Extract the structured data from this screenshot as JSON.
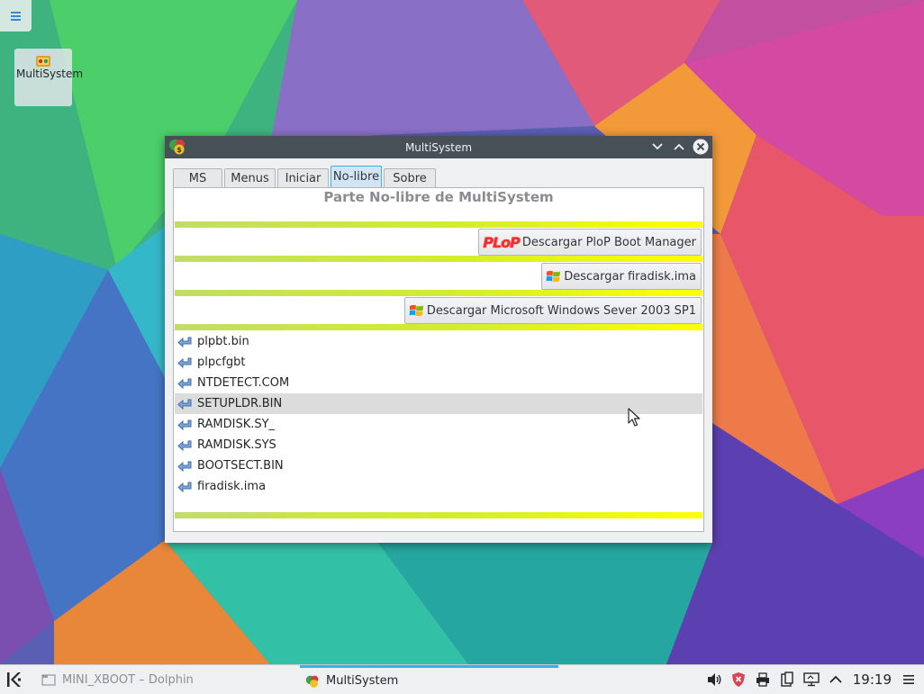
{
  "desktop": {
    "toolbox_icon": "hamburger-menu-icon",
    "icons": [
      {
        "label": "MultiSystem",
        "icon": "multisystem-icon"
      }
    ]
  },
  "window": {
    "title": "MultiSystem",
    "controls": [
      "minimize-chevron-down-icon",
      "maximize-chevron-up-icon",
      "close-icon"
    ],
    "tabs": [
      {
        "label": "MS"
      },
      {
        "label": "Menus"
      },
      {
        "label": "Iniciar"
      },
      {
        "label": "No-libre",
        "active": true
      },
      {
        "label": "Sobre"
      }
    ],
    "panel": {
      "title": "Parte No-libre de MultiSystem",
      "buttons": [
        {
          "label": "Descargar PloP Boot Manager",
          "logo_text": "PLoP"
        },
        {
          "label": "Descargar firadisk.ima",
          "icon": "windows-flag-icon"
        },
        {
          "label": "Descargar Microsoft Windows Sever 2003 SP1",
          "icon": "windows-flag-icon"
        }
      ],
      "files": [
        {
          "name": "plpbt.bin"
        },
        {
          "name": "plpcfgbt"
        },
        {
          "name": "NTDETECT.COM"
        },
        {
          "name": "SETUPLDR.BIN",
          "highlighted": true
        },
        {
          "name": "RAMDISK.SY_"
        },
        {
          "name": "RAMDISK.SYS"
        },
        {
          "name": "BOOTSECT.BIN"
        },
        {
          "name": "firadisk.ima"
        }
      ]
    }
  },
  "taskbar": {
    "tasks": [
      {
        "label": "MINI_XBOOT – Dolphin",
        "active": false
      },
      {
        "label": "MultiSystem",
        "active": true
      }
    ],
    "tray_icons": [
      "volume-icon",
      "security-shield-icon",
      "printer-icon",
      "clipboard-icon",
      "display-icon",
      "expand-up-icon"
    ],
    "clock": "19:19"
  },
  "colors": {
    "titlebar": "#475057",
    "accent": "#3daee9",
    "separator_start": "#c1dd66",
    "separator_end": "#ffff00"
  }
}
